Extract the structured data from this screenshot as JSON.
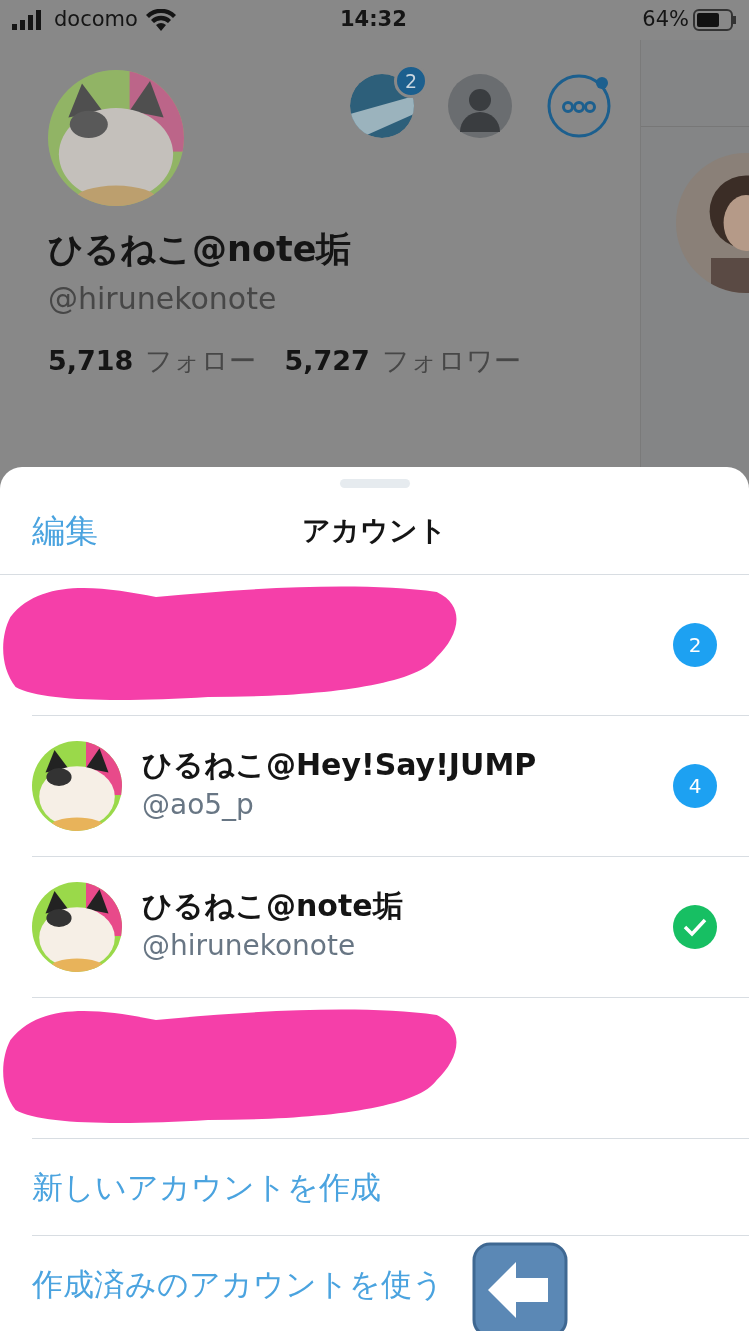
{
  "status_bar": {
    "carrier": "docomo",
    "time": "14:32",
    "battery": "64%"
  },
  "profile": {
    "name": "ひるねこ@note垢",
    "handle": "@hirunekonote",
    "following_count": "5,718",
    "following_label": "フォロー",
    "followers_count": "5,727",
    "followers_label": "フォロワー",
    "account_badge": "2"
  },
  "sheet": {
    "edit": "編集",
    "title": "アカウント",
    "accounts": [
      {
        "kind": "redacted",
        "badge": "2",
        "selected": false
      },
      {
        "kind": "account",
        "name": "ひるねこ@Hey!Say!JUMP",
        "handle": "@ao5_p",
        "badge": "4",
        "selected": false
      },
      {
        "kind": "account",
        "name": "ひるねこ@note垢",
        "handle": "@hirunekonote",
        "selected": true
      },
      {
        "kind": "redacted",
        "selected": false
      }
    ],
    "actions": [
      "新しいアカウントを作成",
      "作成済みのアカウントを使う"
    ]
  }
}
